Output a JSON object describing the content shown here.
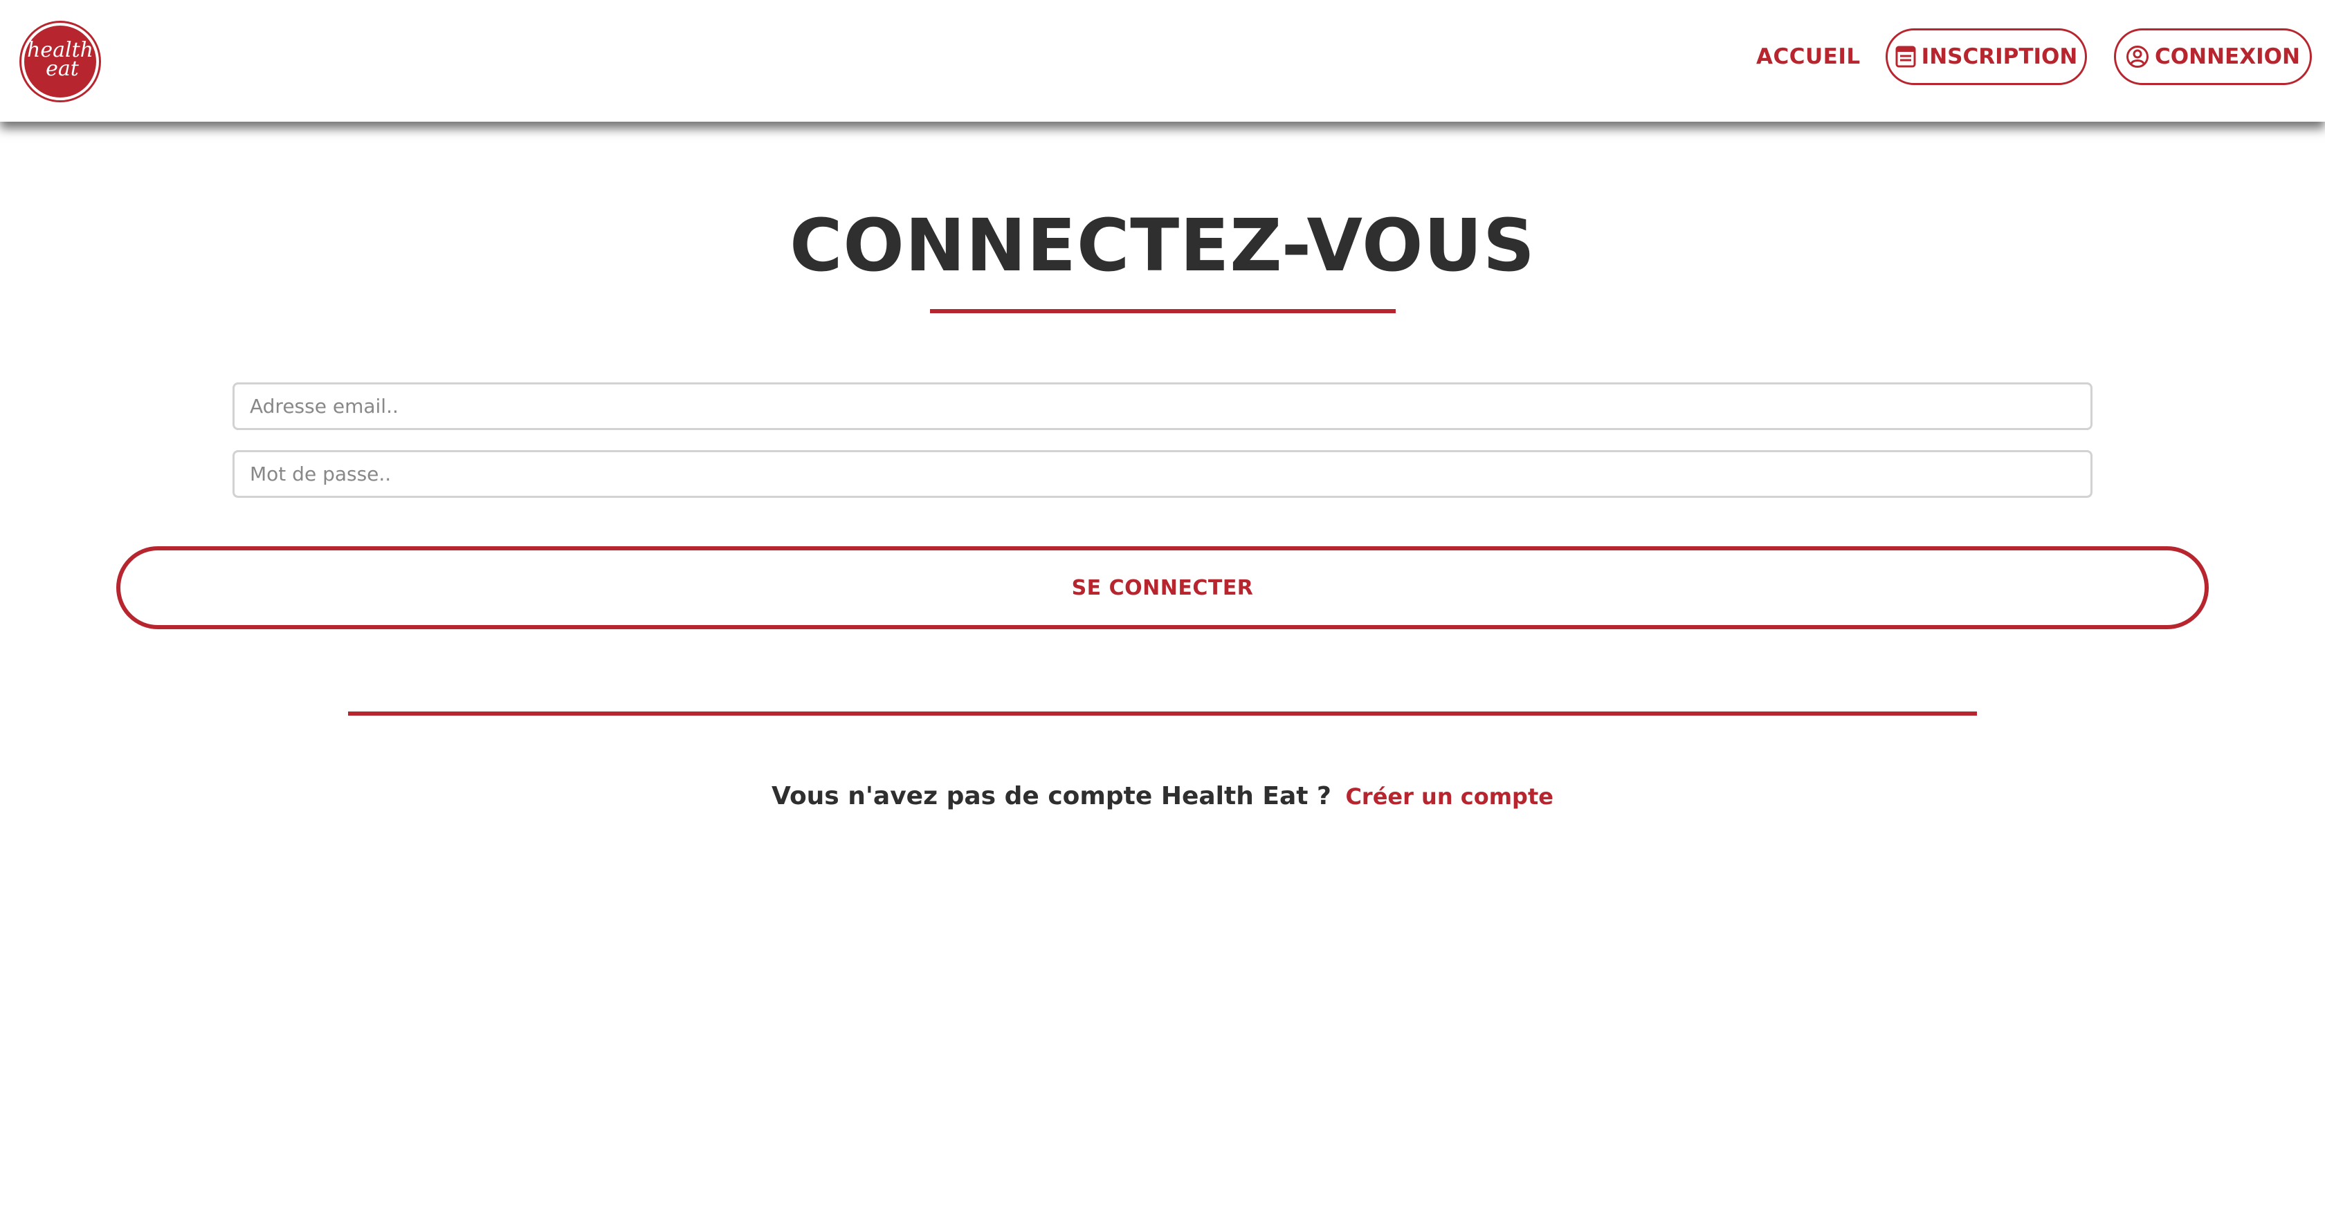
{
  "brand": {
    "logo_line1": "health",
    "logo_line2": "eat",
    "accent_color": "#b7262f",
    "text_color": "#2f2f2f"
  },
  "nav": {
    "accueil": "ACCUEIL",
    "inscription": "INSCRIPTION",
    "connexion": "CONNEXION",
    "inscription_icon": "form-icon",
    "connexion_icon": "user-circle-icon"
  },
  "main": {
    "title": "CONNECTEZ-VOUS",
    "email_placeholder": "Adresse email..",
    "email_value": "",
    "password_placeholder": "Mot de passe..",
    "password_value": "",
    "submit_label": "SE CONNECTER",
    "signup_question": "Vous n'avez pas de compte Health Eat ?",
    "signup_link": "Créer un compte"
  }
}
